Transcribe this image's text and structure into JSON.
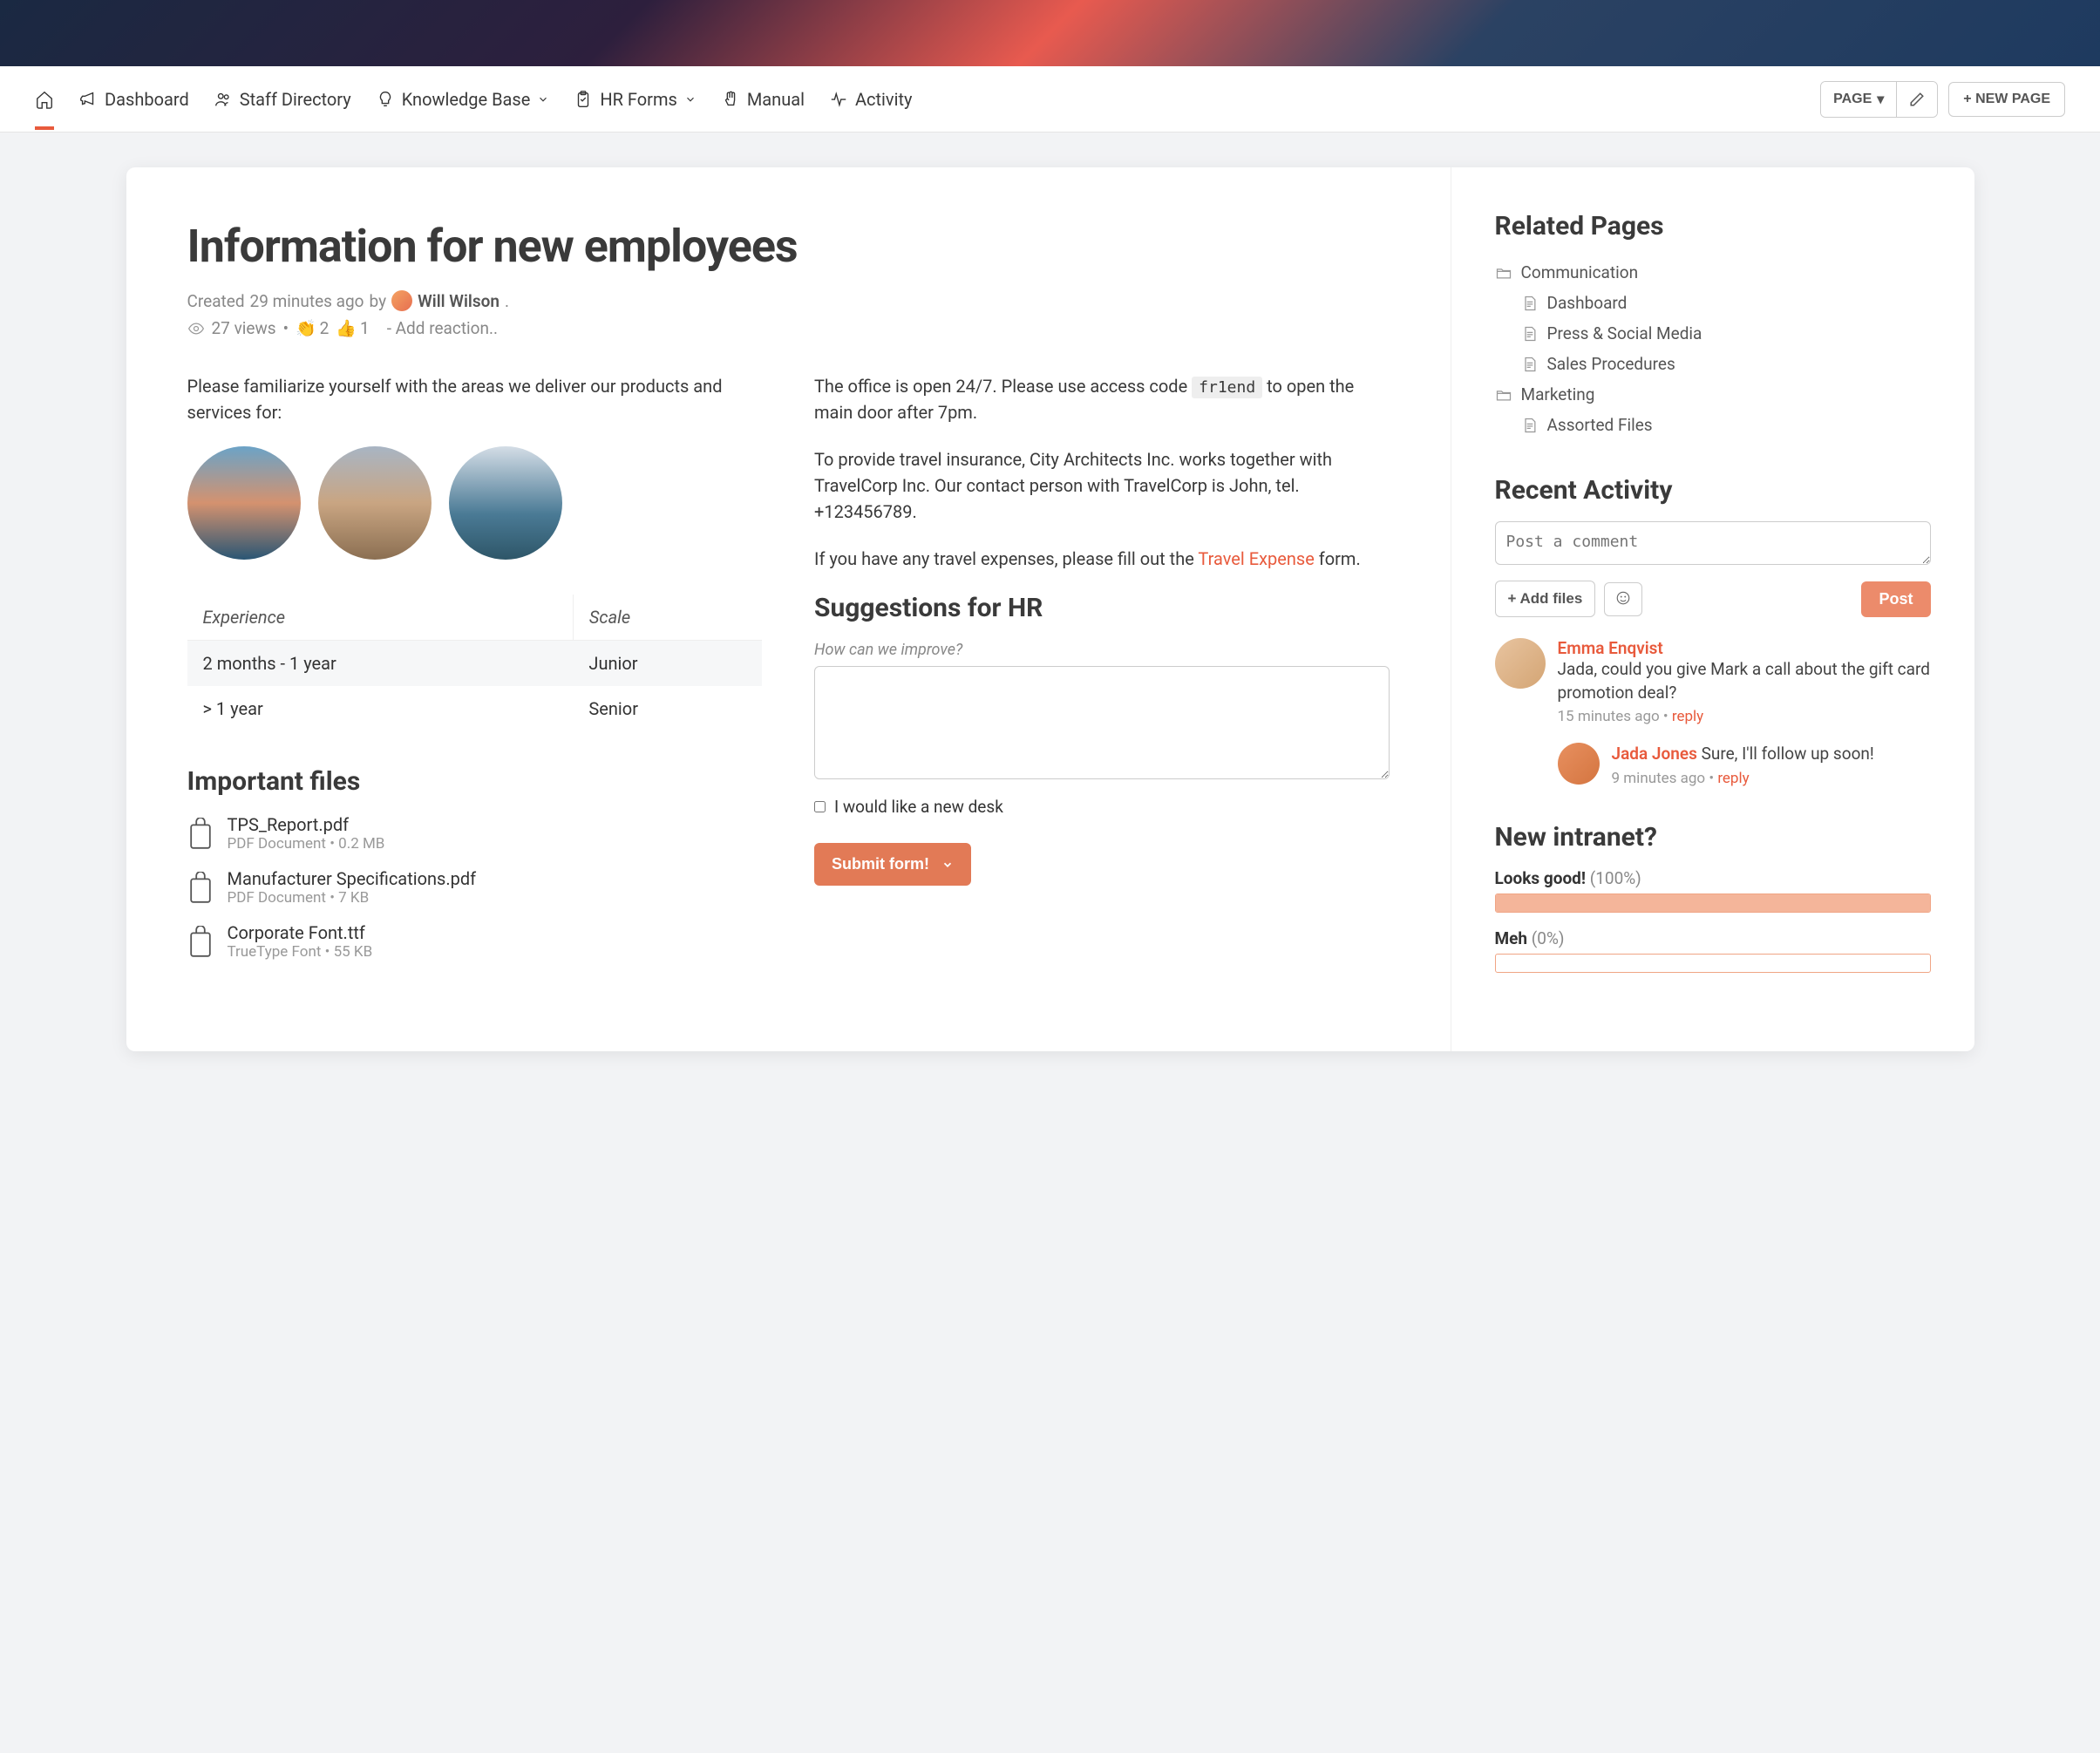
{
  "nav": {
    "items": [
      {
        "label": "Dashboard"
      },
      {
        "label": "Staff Directory"
      },
      {
        "label": "Knowledge Base"
      },
      {
        "label": "HR Forms"
      },
      {
        "label": "Manual"
      },
      {
        "label": "Activity"
      }
    ],
    "page_btn": "PAGE",
    "new_page_btn": "+ NEW PAGE"
  },
  "page": {
    "title": "Information for new employees",
    "created_prefix": "Created ",
    "created_ago": "29 minutes ago",
    "created_by_word": " by ",
    "author": "Will Wilson",
    "views_label": "27 views",
    "clap_count": "2",
    "thumbs_count": "1",
    "add_reaction": "- Add reaction.."
  },
  "left_col": {
    "intro": "Please familiarize yourself with the areas we deliver our products and services for:",
    "table": {
      "headers": [
        "Experience",
        "Scale"
      ],
      "rows": [
        [
          "2 months - 1 year",
          "Junior"
        ],
        [
          "> 1 year",
          "Senior"
        ]
      ]
    },
    "files_heading": "Important files",
    "files": [
      {
        "name": "TPS_Report.pdf",
        "meta": "PDF Document • 0.2 MB"
      },
      {
        "name": "Manufacturer Specifications.pdf",
        "meta": "PDF Document • 7 KB"
      },
      {
        "name": "Corporate Font.ttf",
        "meta": "TrueType Font • 55 KB"
      }
    ]
  },
  "right_col": {
    "office_text_1": "The office is open 24/7. Please use access code ",
    "office_code": "fr1end",
    "office_text_2": " to open the main door after 7pm.",
    "insurance_text": "To provide travel insurance, City Architects Inc. works together with TravelCorp Inc. Our contact person with TravelCorp is John, tel. +123456789.",
    "expenses_text_1": "If you have any travel expenses, please fill out the ",
    "expenses_link": "Travel Expense",
    "expenses_text_2": " form.",
    "suggestions_heading": "Suggestions for HR",
    "suggestions_label": "How can we improve?",
    "checkbox_label": "I would like a new desk",
    "submit_btn": "Submit form!"
  },
  "sidebar": {
    "related_heading": "Related Pages",
    "tree": [
      {
        "type": "folder",
        "label": "Communication"
      },
      {
        "type": "doc",
        "label": "Dashboard"
      },
      {
        "type": "doc",
        "label": "Press & Social Media"
      },
      {
        "type": "doc",
        "label": "Sales Procedures"
      },
      {
        "type": "folder",
        "label": "Marketing"
      },
      {
        "type": "doc",
        "label": "Assorted Files"
      }
    ],
    "activity_heading": "Recent Activity",
    "comment_placeholder": "Post a comment",
    "add_files_btn": "+ Add files",
    "post_btn": "Post",
    "comments": [
      {
        "author": "Emma Enqvist",
        "body": "Jada, could you give Mark a call about the gift card promotion deal?",
        "time": "15 minutes ago",
        "reply_word": "reply"
      },
      {
        "author": "Jada Jones",
        "body": "Sure, I'll follow up soon!",
        "time": "9 minutes ago",
        "reply_word": "reply"
      }
    ],
    "poll_heading": "New intranet?",
    "poll": [
      {
        "label": "Looks good!",
        "pct": "(100%)",
        "fill": 100
      },
      {
        "label": "Meh",
        "pct": "(0%)",
        "fill": 0
      }
    ]
  }
}
